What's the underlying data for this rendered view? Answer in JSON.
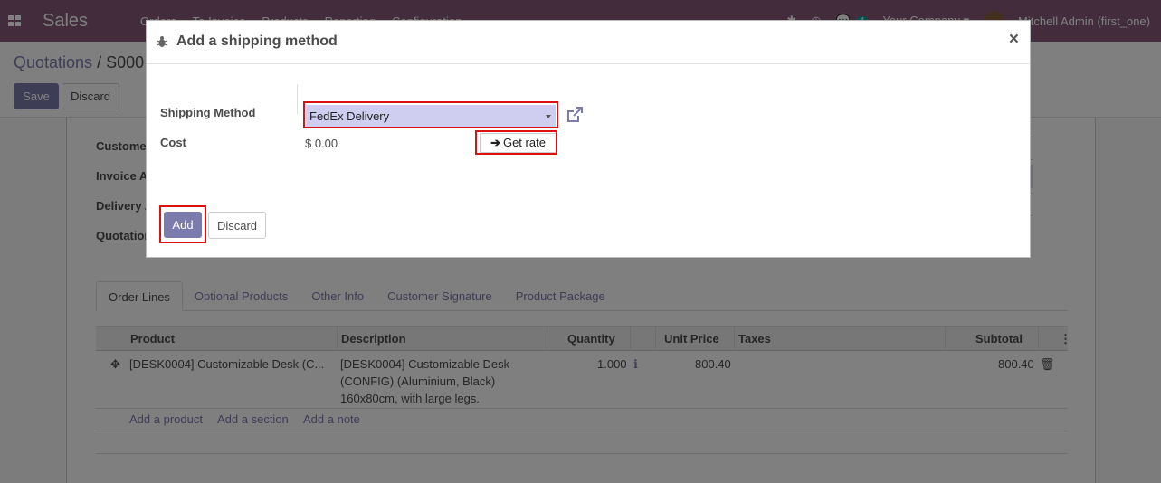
{
  "navbar": {
    "app_name": "Sales",
    "menu": [
      "Orders",
      "To Invoice",
      "Products",
      "Reporting",
      "Configuration"
    ],
    "message_count": "4",
    "company": "Your Company",
    "user": "Mitchell Admin (first_one)"
  },
  "control_panel": {
    "breadcrumb_parent": "Quotations",
    "breadcrumb_sep": "/",
    "breadcrumb_current": "S000",
    "save_label": "Save",
    "discard_label": "Discard"
  },
  "form": {
    "customer_label": "Customer",
    "invoice_label": "Invoice A",
    "delivery_label": "Delivery A",
    "quotation_label": "Quotation"
  },
  "tabs": [
    "Order Lines",
    "Optional Products",
    "Other Info",
    "Customer Signature",
    "Product Package"
  ],
  "order_lines": {
    "headers": {
      "product": "Product",
      "description": "Description",
      "quantity": "Quantity",
      "unit_price": "Unit Price",
      "taxes": "Taxes",
      "subtotal": "Subtotal"
    },
    "rows": [
      {
        "product": "[DESK0004] Customizable Desk (C...",
        "description_1": "[DESK0004] Customizable Desk",
        "description_2": "(CONFIG) (Aluminium, Black)",
        "description_3": "160x80cm, with large legs.",
        "quantity": "1.000",
        "unit_price": "800.40",
        "subtotal": "800.40"
      }
    ],
    "add_product": "Add a product",
    "add_section": "Add a section",
    "add_note": "Add a note"
  },
  "modal": {
    "title": "Add a shipping method",
    "close_glyph": "×",
    "shipping_method_label": "Shipping Method",
    "shipping_method_value": "FedEx Delivery",
    "cost_label": "Cost",
    "cost_value": "$ 0.00",
    "get_rate_arrow": "➔",
    "get_rate_label": "Get rate",
    "add_label": "Add",
    "discard_label": "Discard"
  },
  "colors": {
    "brand": "#875a7b",
    "primary": "#7c7bad",
    "highlight": "#dd1111"
  }
}
